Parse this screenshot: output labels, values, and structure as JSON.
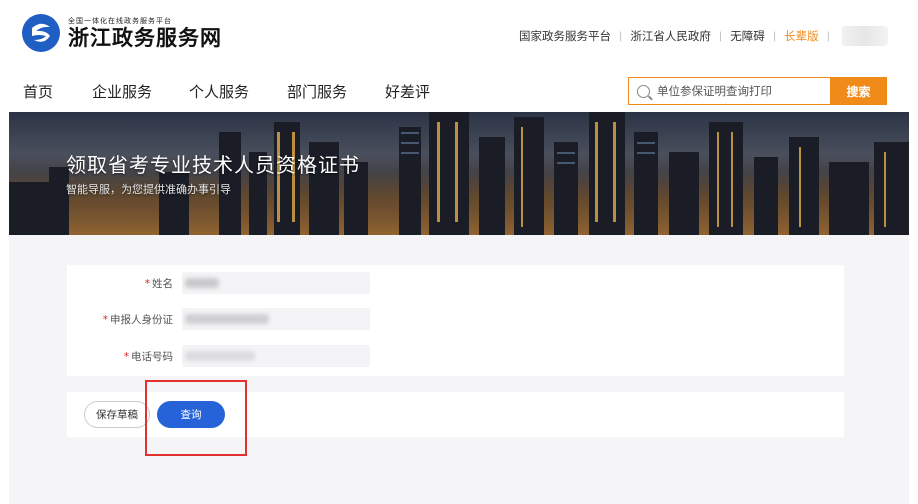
{
  "header": {
    "logo_subtitle": "全国一体化在线政务服务平台",
    "logo_title": "浙江政务服务网",
    "links": {
      "national_platform": "国家政务服务平台",
      "provincial_government": "浙江省人民政府",
      "accessibility": "无障碍",
      "elder_version": "长辈版"
    }
  },
  "nav": {
    "items": [
      "首页",
      "企业服务",
      "个人服务",
      "部门服务",
      "好差评"
    ]
  },
  "search": {
    "placeholder": "单位参保证明查询打印",
    "button_label": "搜索"
  },
  "banner": {
    "title": "领取省考专业技术人员资格证书",
    "subtitle": "智能导服，为您提供准确办事引导"
  },
  "form": {
    "fields": [
      {
        "label": "姓名",
        "required": "*",
        "value": ""
      },
      {
        "label": "申报人身份证",
        "required": "*",
        "value": ""
      },
      {
        "label": "电话号码",
        "required": "*",
        "value": ""
      }
    ]
  },
  "actions": {
    "save_draft": "保存草稿",
    "query": "查询"
  },
  "colors": {
    "accent_orange": "#f08a19",
    "primary_blue": "#2663d8",
    "highlight_red": "#e03030"
  }
}
